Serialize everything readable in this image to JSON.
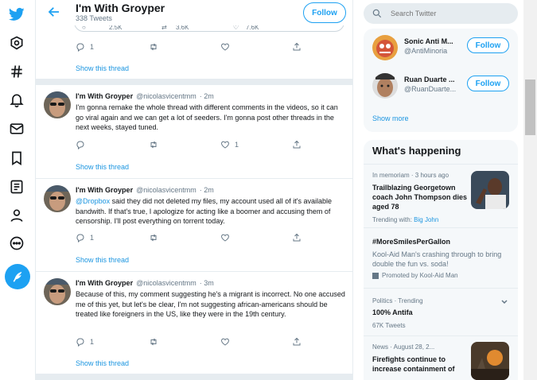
{
  "header": {
    "title": "I'm With Groyper",
    "subtitle": "338 Tweets",
    "follow_label": "Follow"
  },
  "partial_tweet": {
    "replies": "2.5K",
    "retweets": "3.6K",
    "likes": "7.6K",
    "row2_replies": "1",
    "show_thread": "Show this thread"
  },
  "tweets": [
    {
      "name": "I'm With Groyper",
      "handle": "@nicolasvicentmm",
      "time": "· 2m",
      "text": "I'm gonna remake the whole thread with different comments in the videos, so it can go viral again and we can get a lot of seeders. I'm gonna post other threads in the next weeks, stayed tuned.",
      "replies": "",
      "likes": "1",
      "show_thread": "Show this thread"
    },
    {
      "name": "I'm With Groyper",
      "handle": "@nicolasvicentmm",
      "time": "· 2m",
      "mention": "@Dropbox",
      "text": " said they did not deleted my files, my account used all of it's available bandwith. If that's true, I apologize for acting like a boomer and accusing them of censorship. I'll post everything on torrent today.",
      "replies": "1",
      "likes": "",
      "show_thread": "Show this thread"
    },
    {
      "name": "I'm With Groyper",
      "handle": "@nicolasvicentmm",
      "time": "· 3m",
      "text": "Because of this, my comment suggesting he's a migrant is incorrect. No one accused me of this yet, but let's be clear, I'm not suggesting african-americans should be treated like foreigners in the US, like they were in the 19th century.",
      "replies": "1",
      "likes": "",
      "show_thread": "Show this thread"
    }
  ],
  "search": {
    "placeholder": "Search Twitter"
  },
  "who_to_follow": {
    "items": [
      {
        "name": "Sonic Anti M...",
        "handle": "@AntiMinoria",
        "follow": "Follow"
      },
      {
        "name": "Ruan Duarte ...",
        "handle": "@RuanDuarte...",
        "follow": "Follow"
      }
    ],
    "show_more": "Show more"
  },
  "whats_happening": {
    "title": "What's happening",
    "trends": [
      {
        "meta": "In memoriam · 3 hours ago",
        "title": "Trailblazing Georgetown coach John Thompson dies aged 78",
        "extra_prefix": "Trending with: ",
        "extra_link": "Big John"
      },
      {
        "title": "#MoreSmilesPerGallon",
        "desc": "Kool-Aid Man's crashing through to bring double the fun vs. soda!",
        "promoted": "Promoted by Kool-Aid Man"
      },
      {
        "meta": "Politics · Trending",
        "title": "100% Antifa",
        "count": "67K Tweets"
      },
      {
        "meta": "News · August 28, 2...",
        "title": "Firefights continue to increase containment of"
      }
    ]
  },
  "colors": {
    "accent": "#1da1f2",
    "link": "#1b95e0",
    "muted": "#657786"
  }
}
